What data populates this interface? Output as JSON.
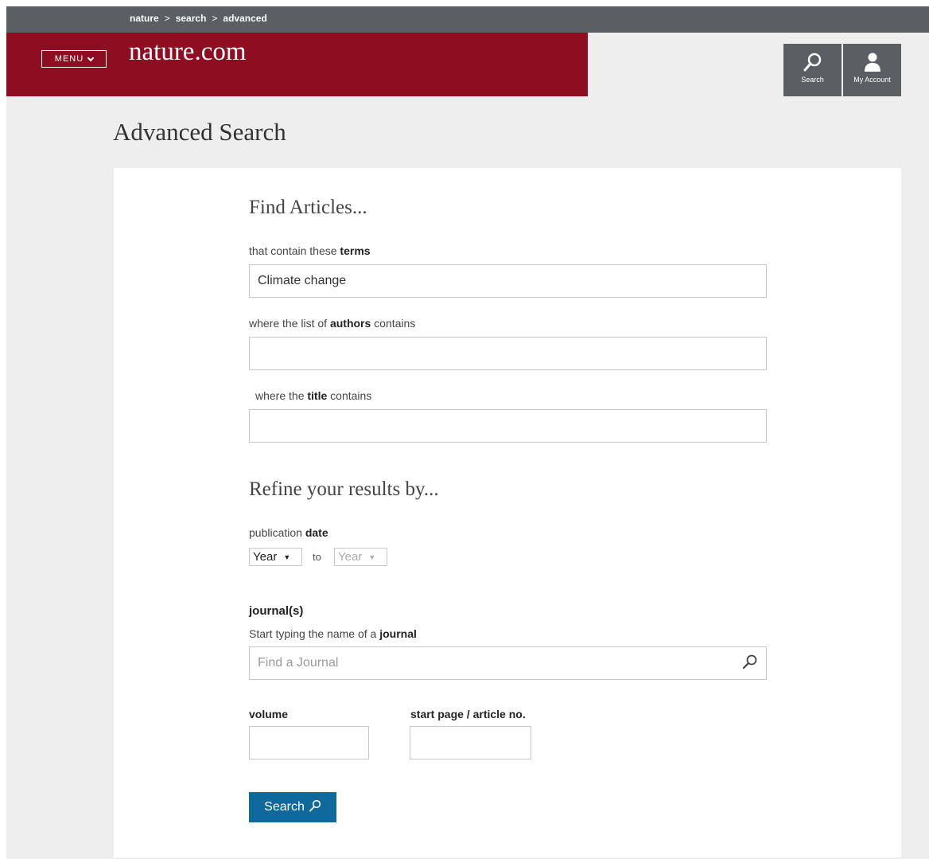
{
  "breadcrumb": [
    "nature",
    "search",
    "advanced"
  ],
  "breadcrumb_separator": ">",
  "header": {
    "menu_label": "MENU",
    "logo_text": "nature.com",
    "search_label": "Search",
    "account_label": "My Account"
  },
  "page_title": "Advanced Search",
  "find": {
    "heading": "Find Articles...",
    "terms_label_pre": "that contain these ",
    "terms_label_bold": "terms",
    "terms_value": "Climate change",
    "authors_label_pre": "where the list of ",
    "authors_label_bold": "authors",
    "authors_label_post": " contains",
    "title_label_pre": "where the ",
    "title_label_bold": "title",
    "title_label_post": " contains"
  },
  "refine": {
    "heading": "Refine your results by...",
    "date_label_pre": "publication ",
    "date_label_bold": "date",
    "from_year": "Year",
    "to_text": "to",
    "to_year": "Year",
    "journal_heading": "journal(s)",
    "journal_hint_pre": "Start typing the name of a ",
    "journal_hint_bold": "journal",
    "journal_placeholder": "Find a Journal",
    "volume_label": "volume",
    "page_label": "start page / article no.",
    "search_button": "Search"
  },
  "colors": {
    "brand_red": "#8f0d21",
    "dark_gray": "#5b5e62",
    "button_blue": "#0e6a9c"
  }
}
